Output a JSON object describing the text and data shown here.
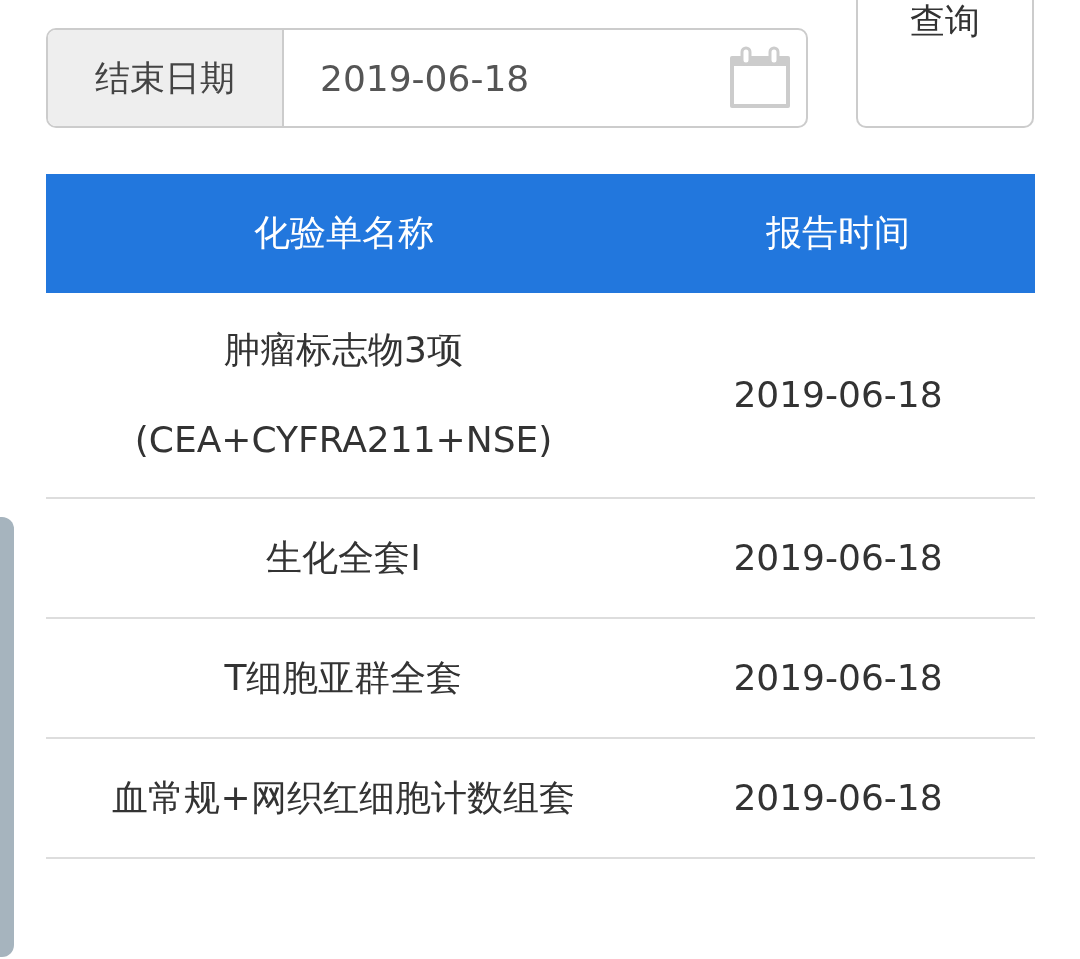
{
  "date_filter": {
    "label": "结束日期",
    "value": "2019-06-18"
  },
  "query_button": "查询",
  "table": {
    "columns": [
      "化验单名称",
      "报告时间"
    ],
    "rows": [
      {
        "name": "肿瘤标志物3项(CEA+CYFRA211+NSE)",
        "time": "2019-06-18"
      },
      {
        "name": "生化全套I",
        "time": "2019-06-18"
      },
      {
        "name": "T细胞亚群全套",
        "time": "2019-06-18"
      },
      {
        "name": "血常规+网织红细胞计数组套",
        "time": "2019-06-18"
      }
    ]
  }
}
